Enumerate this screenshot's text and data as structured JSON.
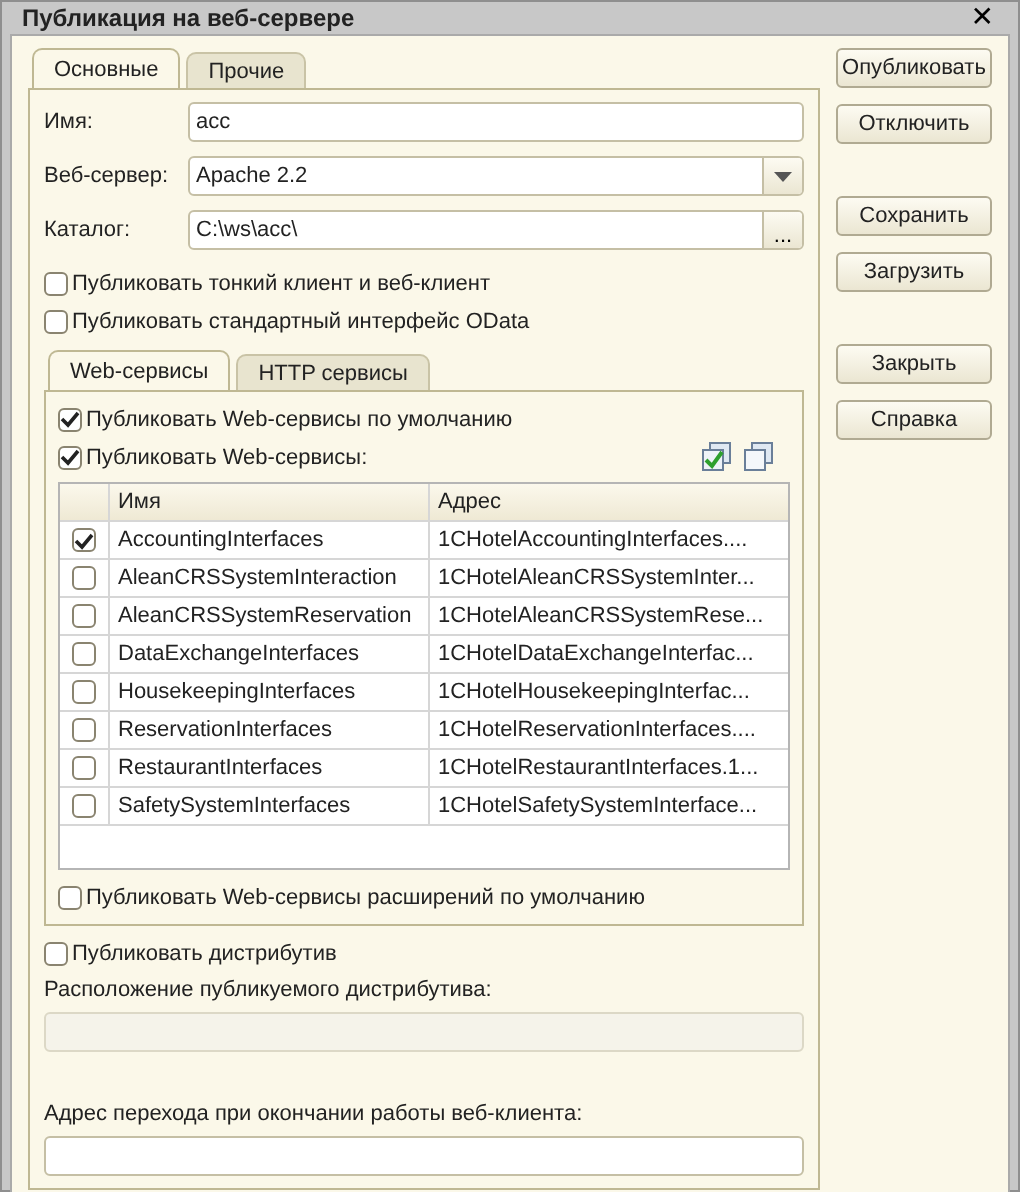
{
  "window": {
    "title": "Публикация на веб-сервере",
    "close": "✕"
  },
  "tabs": [
    {
      "label": "Основные",
      "selected": true
    },
    {
      "label": "Прочие",
      "selected": false
    }
  ],
  "fields": [
    {
      "kind": "text",
      "label": "Имя:",
      "value": "acc"
    },
    {
      "kind": "dropdown",
      "label": "Веб-сервер:",
      "value": "Apache 2.2"
    },
    {
      "kind": "browse",
      "label": "Каталог:",
      "value": "C:\\ws\\acc\\",
      "button": "..."
    }
  ],
  "options": [
    {
      "label": "Публиковать тонкий клиент и веб-клиент",
      "checked": false
    },
    {
      "label": "Публиковать стандартный интерфейс OData",
      "checked": false
    }
  ],
  "inner_tabs": [
    {
      "label": "Web-сервисы",
      "selected": true
    },
    {
      "label": "HTTP сервисы",
      "selected": false
    }
  ],
  "ws_options": [
    {
      "label": "Публиковать Web-сервисы по умолчанию",
      "checked": true
    },
    {
      "label": "Публиковать Web-сервисы:",
      "checked": true
    }
  ],
  "services_table": {
    "columns": [
      "Имя",
      "Адрес"
    ],
    "rows": [
      {
        "checked": true,
        "name": "AccountingInterfaces",
        "address": "1CHotelAccountingInterfaces...."
      },
      {
        "checked": false,
        "name": "AleanCRSSystemInteraction",
        "address": "1CHotelAleanCRSSystemInter..."
      },
      {
        "checked": false,
        "name": "AleanCRSSystemReservation",
        "address": "1CHotelAleanCRSSystemRese..."
      },
      {
        "checked": false,
        "name": "DataExchangeInterfaces",
        "address": "1CHotelDataExchangeInterfac..."
      },
      {
        "checked": false,
        "name": "HousekeepingInterfaces",
        "address": "1CHotelHousekeepingInterfac..."
      },
      {
        "checked": false,
        "name": "ReservationInterfaces",
        "address": "1CHotelReservationInterfaces...."
      },
      {
        "checked": false,
        "name": "RestaurantInterfaces",
        "address": "1CHotelRestaurantInterfaces.1..."
      },
      {
        "checked": false,
        "name": "SafetySystemInterfaces",
        "address": "1CHotelSafetySystemInterface..."
      }
    ]
  },
  "ext_option": {
    "label": "Публиковать Web-сервисы расширений по умолчанию",
    "checked": false
  },
  "distrib_option": {
    "label": "Публиковать дистрибутив",
    "checked": false
  },
  "distrib_location": {
    "label": "Расположение публикуемого дистрибутива:",
    "disabled": true
  },
  "exit_address": {
    "label": "Адрес перехода при окончании работы веб-клиента:",
    "disabled": false
  },
  "button_groups": [
    [
      "Опубликовать",
      "Отключить"
    ],
    [
      "Сохранить",
      "Загрузить"
    ],
    [
      "Закрыть",
      "Справка"
    ]
  ]
}
